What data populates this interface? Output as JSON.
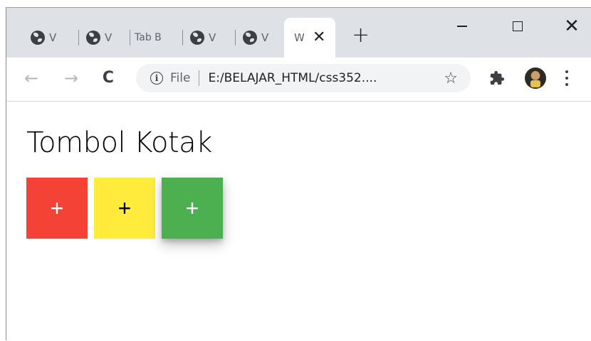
{
  "tabs": [
    {
      "title": "V"
    },
    {
      "title": "V"
    },
    {
      "title": "Tab B"
    },
    {
      "title": "V"
    },
    {
      "title": "V"
    },
    {
      "title": "W",
      "active": true
    }
  ],
  "toolbar": {
    "file_label": "File",
    "url": "E:/BELAJAR_HTML/css352...."
  },
  "page": {
    "title": "Tombol Kotak",
    "buttons": [
      {
        "label": "+",
        "color": "#f44336",
        "text_color": "#ffffff"
      },
      {
        "label": "+",
        "color": "#ffeb3b",
        "text_color": "#000000"
      },
      {
        "label": "+",
        "color": "#4caf50",
        "text_color": "#ffffff",
        "shadow": true
      }
    ]
  },
  "icons": {
    "back": "←",
    "forward": "→",
    "reload": "C",
    "info": "i",
    "star": "☆",
    "tab_close": "✕",
    "new_tab": "+",
    "window_close": "✕"
  }
}
